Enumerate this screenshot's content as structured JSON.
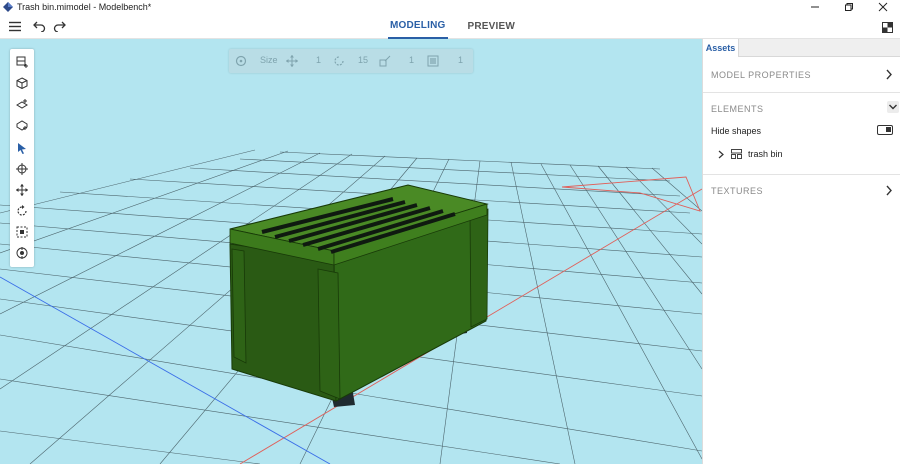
{
  "window": {
    "title": "Trash bin.mimodel - Modelbench*"
  },
  "menubar": {
    "tabs": [
      {
        "label": "MODELING",
        "active": true
      },
      {
        "label": "PREVIEW",
        "active": false
      }
    ]
  },
  "viewport_toolbar": {
    "size_label": "Size",
    "move_value": "1",
    "rotate_value": "15",
    "scale_value": "1",
    "snap_value": "1"
  },
  "sidebar": {
    "tab_label": "Assets",
    "model_properties_label": "MODEL PROPERTIES",
    "elements_label": "ELEMENTS",
    "hide_shapes_label": "Hide shapes",
    "hide_shapes_on": false,
    "tree": [
      {
        "label": "trash bin",
        "expanded": false
      }
    ],
    "textures_label": "TEXTURES"
  },
  "colors": {
    "accent": "#2a5fa6",
    "viewport_background": "#b3e5f0",
    "model_body": "#285a14",
    "model_lid": "#4a8a25"
  }
}
